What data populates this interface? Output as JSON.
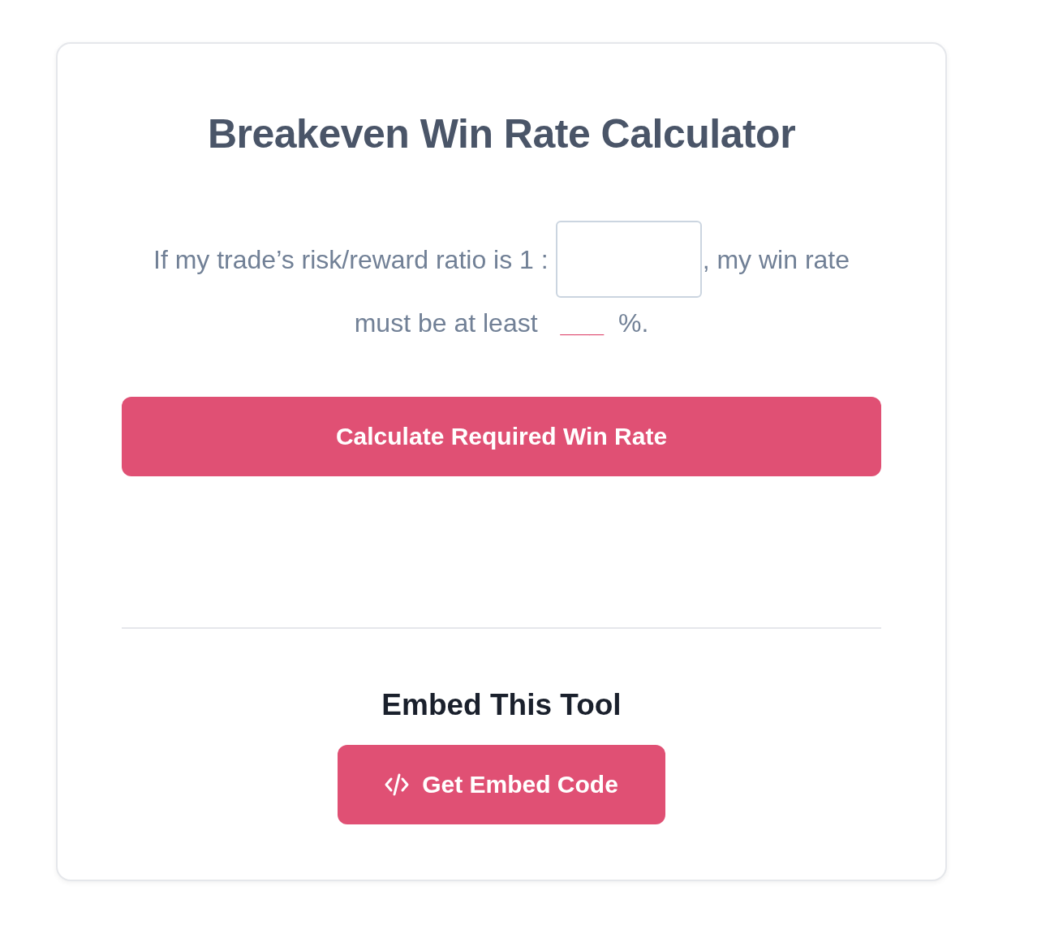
{
  "title": "Breakeven Win Rate Calculator",
  "sentence": {
    "before_input": "If my trade’s risk/reward ratio is 1 :",
    "after_input": ", my win rate",
    "second_line": "must be at least",
    "result": "___",
    "suffix": "%."
  },
  "calculate_button": "Calculate Required Win Rate",
  "embed": {
    "heading": "Embed This Tool",
    "button": "Get Embed Code"
  }
}
